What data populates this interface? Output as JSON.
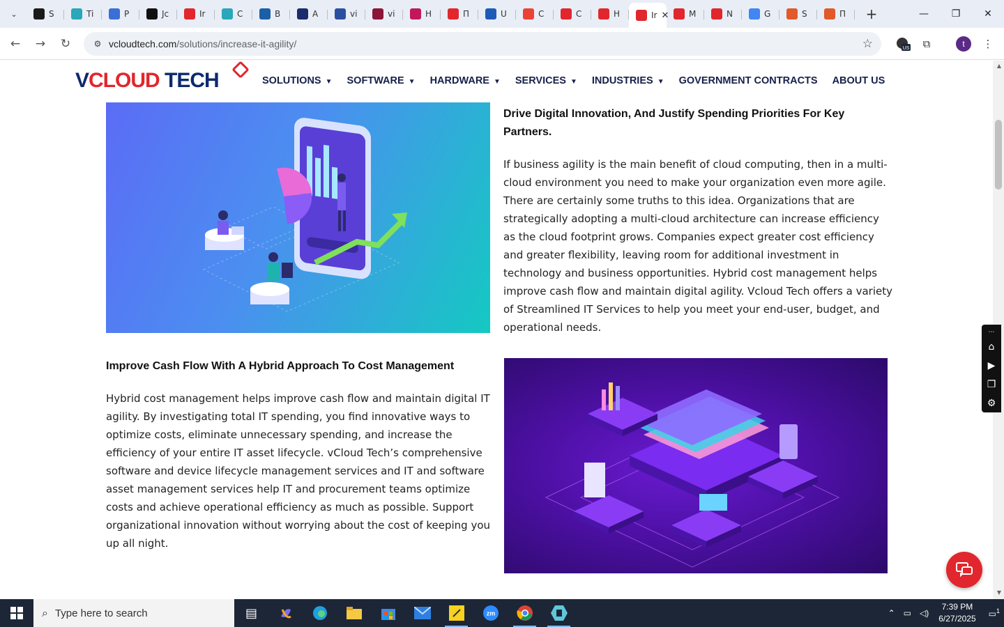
{
  "browser": {
    "tabs": [
      {
        "label": "S",
        "color": "#1a1a1a"
      },
      {
        "label": "Ti",
        "color": "#2aa7b8"
      },
      {
        "label": "P",
        "color": "#3a6fd8"
      },
      {
        "label": "Jc",
        "color": "#111111"
      },
      {
        "label": "Ir",
        "color": "#e1262d"
      },
      {
        "label": "C",
        "color": "#2aa7b8"
      },
      {
        "label": "B",
        "color": "#1b5fa8"
      },
      {
        "label": "A",
        "color": "#1b2b6b"
      },
      {
        "label": "vi",
        "color": "#2b4fa0"
      },
      {
        "label": "vi",
        "color": "#8a1538"
      },
      {
        "label": "H",
        "color": "#c2185b"
      },
      {
        "label": "П",
        "color": "#e1262d"
      },
      {
        "label": "U",
        "color": "#1e5bb8"
      },
      {
        "label": "C",
        "color": "#ea4335"
      },
      {
        "label": "C",
        "color": "#e1262d"
      },
      {
        "label": "H",
        "color": "#e1262d"
      },
      {
        "label": "Ir",
        "color": "#e1262d",
        "active": true
      },
      {
        "label": "M",
        "color": "#e1262d"
      },
      {
        "label": "N",
        "color": "#e1262d"
      },
      {
        "label": "G",
        "color": "#4285f4"
      },
      {
        "label": "S",
        "color": "#e05a2a"
      },
      {
        "label": "П",
        "color": "#e05a2a"
      }
    ],
    "url_domain": "vcloudtech.com",
    "url_path": "/solutions/increase-it-agility/",
    "profile_initial": "t",
    "extension_badge": "US"
  },
  "site": {
    "logo": {
      "v": "V",
      "cloud": "CLOUD",
      "tech": " TECH"
    },
    "nav": [
      {
        "label": "SOLUTIONS",
        "dropdown": true
      },
      {
        "label": "SOFTWARE",
        "dropdown": true
      },
      {
        "label": "HARDWARE",
        "dropdown": true
      },
      {
        "label": "SERVICES",
        "dropdown": true
      },
      {
        "label": "INDUSTRIES",
        "dropdown": true
      },
      {
        "label": "GOVERNMENT CONTRACTS",
        "dropdown": false
      },
      {
        "label": "ABOUT US",
        "dropdown": false
      }
    ],
    "section1": {
      "heading": "Drive Digital Innovation, And Justify Spending Priorities For Key Partners.",
      "body": "If business agility is the main benefit of cloud computing, then in a multi-cloud environment you need to make your organization even more agile. There are certainly some truths to this idea. Organizations that are strategically adopting a multi-cloud architecture can increase efficiency as the cloud footprint grows. Companies expect greater cost efficiency and greater flexibility, leaving room for additional investment in technology and business opportunities. Hybrid cost management helps improve cash flow and maintain digital agility. Vcloud Tech offers a variety of Streamlined IT Services to help you meet your end-user, budget, and operational needs."
    },
    "section2": {
      "heading": "Improve Cash Flow With A Hybrid Approach To Cost Management",
      "body": "Hybrid cost management helps improve cash flow and maintain digital IT agility. By investigating total IT spending, you find innovative ways to optimize costs, eliminate unnecessary spending, and increase the efficiency of your entire IT asset lifecycle. vCloud Tech’s comprehensive software and device lifecycle management services and IT and software asset management services help IT and procurement teams optimize costs and achieve operational efficiency as much as possible. Support organizational innovation without worrying about the cost of keeping you up all night."
    },
    "accent_color": "#e1262d",
    "navy_color": "#17204a"
  },
  "taskbar": {
    "search_placeholder": "Type here to search",
    "time": "7:39 PM",
    "date": "6/27/2025",
    "notification_count": "1"
  }
}
